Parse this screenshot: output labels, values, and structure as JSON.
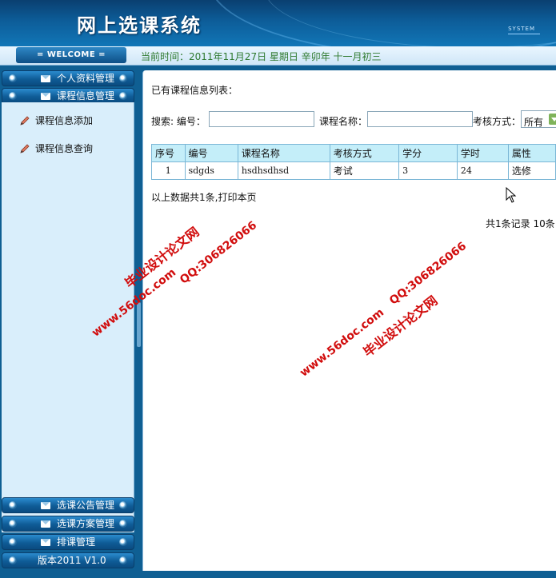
{
  "header": {
    "title": "网上选课系统",
    "system_label": "SYSTEM"
  },
  "infobar": {
    "welcome": "= WELCOME =",
    "current_time": "当前时间：2011年11月27日  星期日  辛卯年  十一月初三"
  },
  "sidebar": {
    "menus_top": [
      {
        "label": "个人资料管理"
      },
      {
        "label": "课程信息管理"
      }
    ],
    "submenu": [
      {
        "label": "课程信息添加"
      },
      {
        "label": "课程信息查询"
      }
    ],
    "menus_bottom": [
      {
        "label": "选课公告管理"
      },
      {
        "label": "选课方案管理"
      },
      {
        "label": "排课管理"
      },
      {
        "label": "版本2011 V1.0"
      }
    ]
  },
  "main": {
    "list_title": "已有课程信息列表：",
    "search": {
      "prefix_label": "搜索: 编号：",
      "name_label": "课程名称：",
      "exam_label": "考核方式：",
      "code_value": "",
      "name_value": "",
      "exam_selected": "所有"
    },
    "table": {
      "headers": [
        "序号",
        "编号",
        "课程名称",
        "考核方式",
        "学分",
        "学时",
        "属性"
      ],
      "rows": [
        [
          "1",
          "sdgds",
          "hsdhsdhsd",
          "考试",
          "3",
          "24",
          "选修"
        ]
      ]
    },
    "summary": "以上数据共1条,打印本页",
    "pager": "共1条记录   10条"
  },
  "watermarks": {
    "site": "www.56doc.com",
    "qq": "QQ:306826066",
    "name": "毕业设计论文网"
  },
  "colors": {
    "header_blue": "#0d5d99",
    "sidebar_bg": "#0f5f93",
    "submenu_bg": "#d9eefb",
    "table_header_bg": "#c4eef9",
    "watermark_red": "#d10c0c",
    "time_green": "#2f7a2f"
  }
}
